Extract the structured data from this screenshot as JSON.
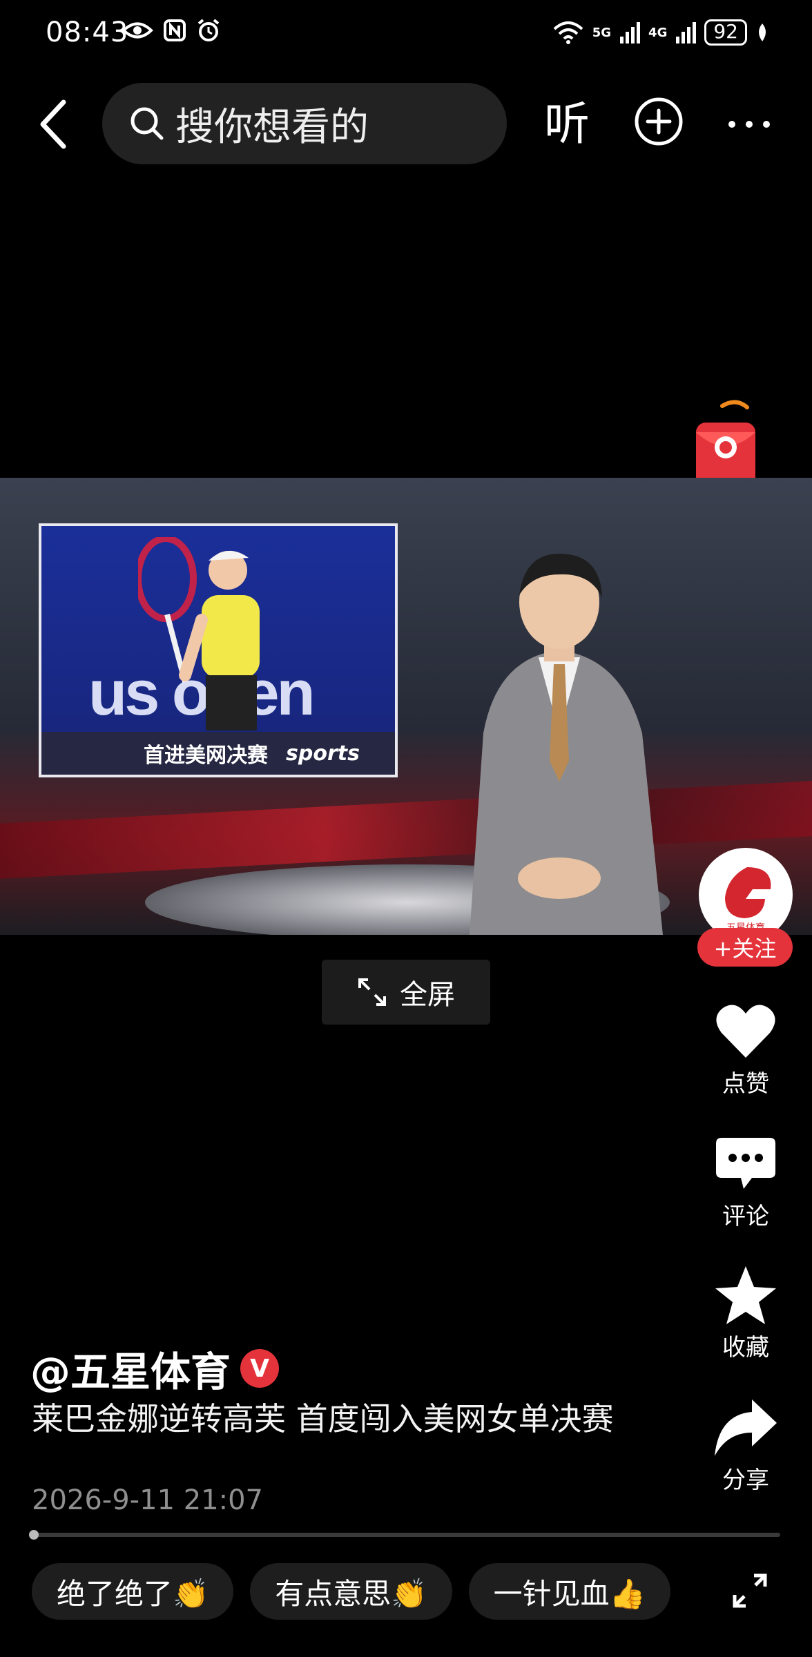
{
  "status_bar": {
    "time": "08:43",
    "battery": "92",
    "net1": "5G",
    "net2": "4G"
  },
  "top_bar": {
    "search_placeholder": "搜你想看的",
    "listen_label": "听",
    "icons": [
      "back-icon",
      "search-icon",
      "add-icon",
      "more-icon"
    ]
  },
  "video": {
    "inset_caption": "首进美网决赛",
    "inset_brand": "sports",
    "inset_logo": "us open"
  },
  "fullscreen_label": "全屏",
  "side_actions": {
    "avatar_text": "五星体育",
    "follow_label": "+关注",
    "like_label": "点赞",
    "comment_label": "评论",
    "favorite_label": "收藏",
    "share_label": "分享"
  },
  "post": {
    "author": "@五星体育",
    "verified_mark": "V",
    "description": "莱巴金娜逆转高芙 首度闯入美网女单决赛",
    "date": "2026-9-11 21:07"
  },
  "quick_comments": [
    "绝了绝了👏",
    "有点意思👏",
    "一针见血👍"
  ],
  "colors": {
    "accent_red": "#e5333b",
    "background": "#000000"
  }
}
